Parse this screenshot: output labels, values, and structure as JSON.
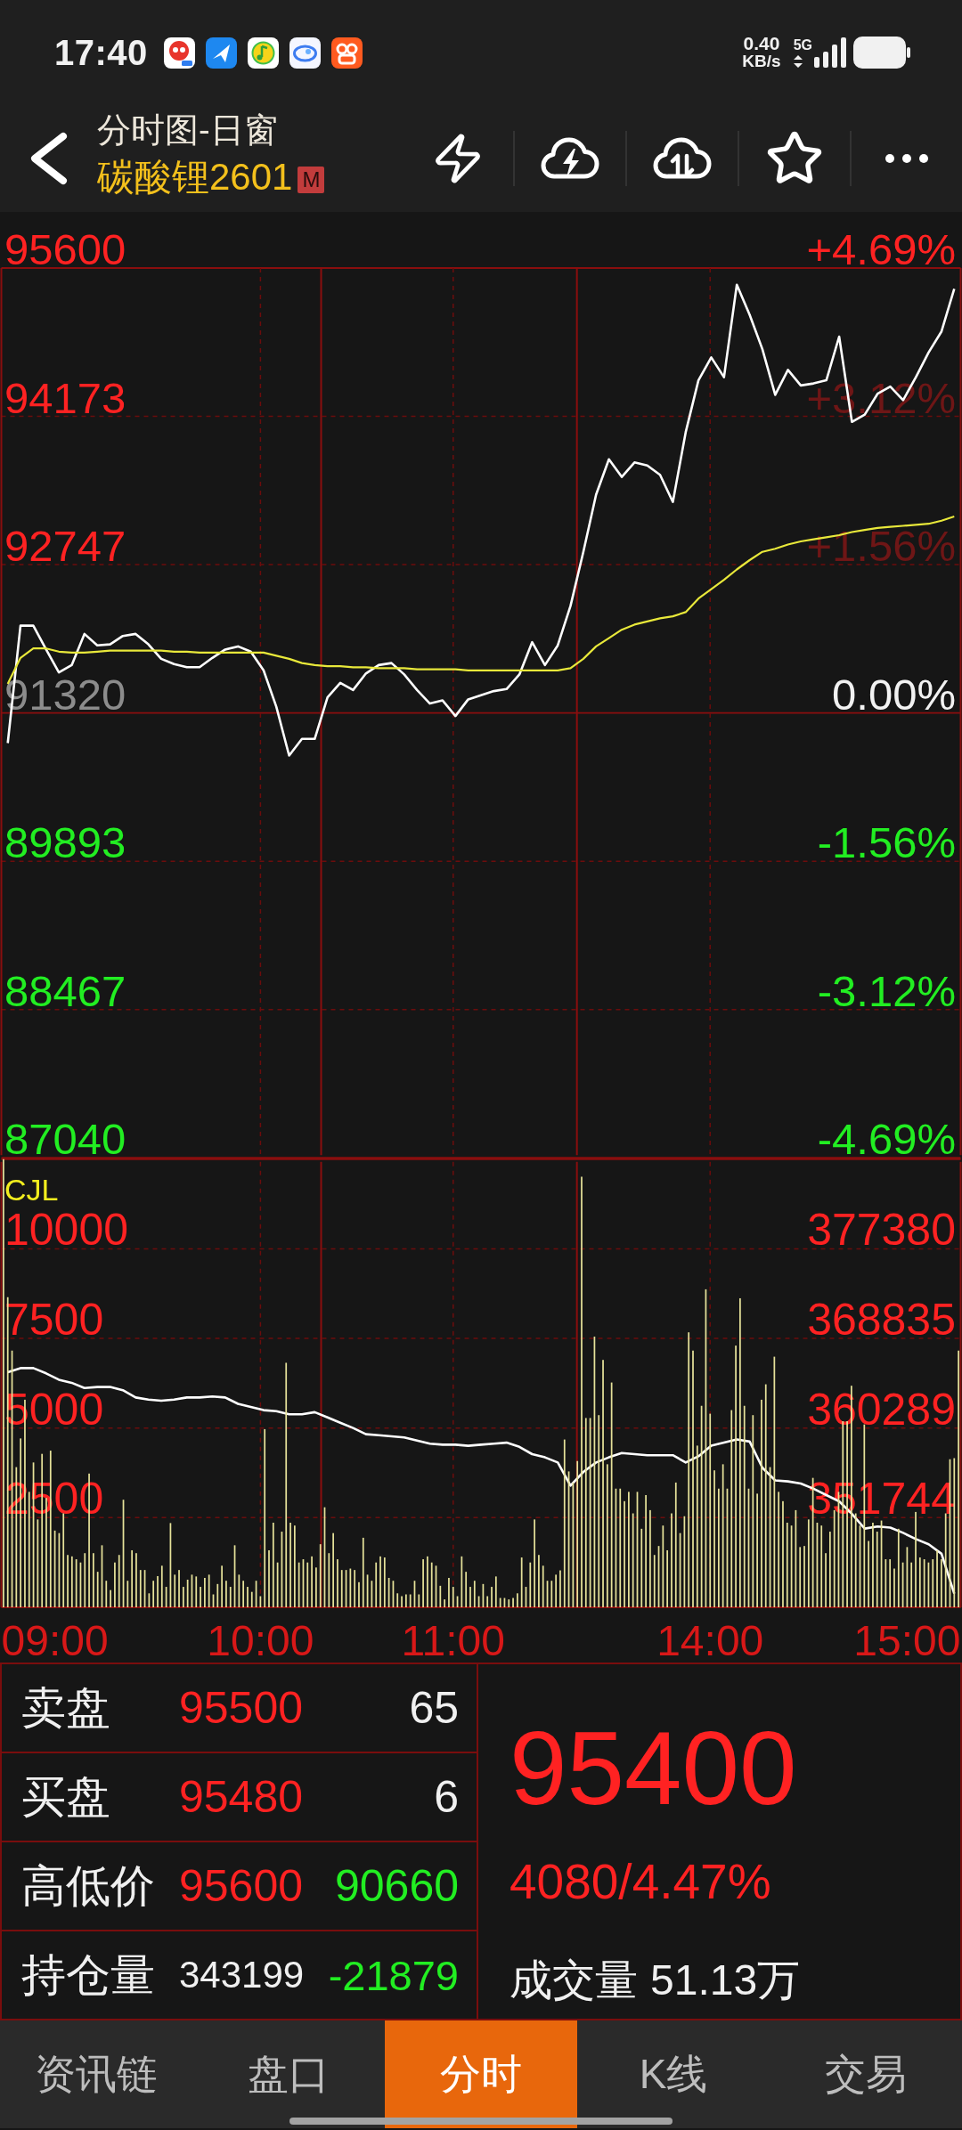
{
  "status_bar": {
    "time": "17:40",
    "net_speed": "0.40",
    "net_speed_unit": "KB/s",
    "network": "5G"
  },
  "header": {
    "title": "分时图-日窗",
    "contract": "碳酸锂2601",
    "badge": "M"
  },
  "price_chart": {
    "percent_labels": [
      {
        "text": "+4.69%",
        "dimmed": false
      },
      {
        "text": "+3.12%",
        "dimmed": true
      },
      {
        "text": "+1.56%",
        "dimmed": true
      },
      {
        "text": "0.00%",
        "dimmed": false
      },
      {
        "text": "-1.56%",
        "dimmed": false
      },
      {
        "text": "-3.12%",
        "dimmed": false
      },
      {
        "text": "-4.69%",
        "dimmed": false
      }
    ],
    "chart_data": {
      "type": "line",
      "grid": true,
      "categories": [
        null,
        null,
        null,
        null,
        null,
        null,
        null,
        null,
        null,
        null,
        null,
        null,
        null,
        null,
        null,
        null,
        null,
        null,
        null,
        null,
        null,
        null,
        null,
        null,
        null,
        null,
        null,
        null,
        null,
        null,
        null,
        null,
        null,
        null,
        null,
        null,
        null,
        null,
        null,
        null,
        null,
        null,
        null,
        null,
        null,
        null,
        null,
        null,
        null,
        null,
        null,
        null,
        null,
        null,
        null,
        null,
        null,
        null,
        null,
        null,
        null,
        null,
        null,
        null,
        null,
        null,
        null,
        null,
        null,
        null,
        null,
        null,
        null,
        null,
        null
      ],
      "series": [
        {
          "color": "#ffffff",
          "values": [
            91030,
            92160,
            92160,
            91930,
            91710,
            91780,
            92080,
            91970,
            91980,
            92060,
            92080,
            91980,
            91840,
            91790,
            91760,
            91760,
            91850,
            91930,
            91960,
            91910,
            91730,
            91380,
            90910,
            91070,
            91070,
            91470,
            91610,
            91540,
            91700,
            91780,
            91800,
            91690,
            91540,
            91410,
            91440,
            91290,
            91450,
            91490,
            91530,
            91550,
            91690,
            92000,
            91780,
            91970,
            92350,
            92870,
            93420,
            93760,
            93590,
            93730,
            93700,
            93610,
            93350,
            94020,
            94520,
            94740,
            94550,
            95440,
            95150,
            94820,
            94380,
            94620,
            94470,
            94490,
            94520,
            94940,
            94120,
            94190,
            94390,
            94460,
            94330,
            94550,
            94790,
            94990,
            95400
          ]
        },
        {
          "color": "#e8e83a",
          "values": [
            91600,
            91850,
            91940,
            91940,
            91910,
            91900,
            91900,
            91910,
            91920,
            91920,
            91920,
            91920,
            91920,
            91910,
            91910,
            91900,
            91900,
            91900,
            91900,
            91900,
            91900,
            91870,
            91840,
            91800,
            91780,
            91770,
            91770,
            91760,
            91760,
            91750,
            91750,
            91750,
            91740,
            91740,
            91740,
            91740,
            91730,
            91730,
            91730,
            91730,
            91730,
            91730,
            91730,
            91730,
            91750,
            91840,
            91960,
            92040,
            92120,
            92170,
            92200,
            92230,
            92250,
            92290,
            92420,
            92510,
            92600,
            92700,
            92790,
            92870,
            92900,
            92940,
            92970,
            92990,
            93010,
            93030,
            93060,
            93080,
            93100,
            93110,
            93120,
            93130,
            93140,
            93170,
            93210
          ]
        }
      ],
      "ylim": [
        87040,
        95600
      ],
      "yticks": [
        {
          "value": 95600,
          "label": "95600"
        },
        {
          "value": 94173.33,
          "label": "94173"
        },
        {
          "value": 92746.67,
          "label": "92747"
        },
        {
          "value": 91320,
          "label": "91320"
        },
        {
          "value": 89893.33,
          "label": "89893"
        },
        {
          "value": 88466.67,
          "label": "88467"
        },
        {
          "value": 87040,
          "label": "87040"
        }
      ]
    }
  },
  "volume_chart": {
    "label": "CJL",
    "chart_data": {
      "type": "bar",
      "grid": true,
      "categories": [
        null,
        null,
        null,
        null,
        null,
        null,
        null,
        null,
        null,
        null,
        null,
        null,
        "09:00",
        null,
        null,
        null,
        null,
        null,
        null,
        null,
        null,
        null,
        null,
        null,
        null,
        null,
        null,
        null,
        null,
        null,
        null,
        null,
        null,
        null,
        null,
        null,
        null,
        null,
        null,
        null,
        null,
        null,
        null,
        null,
        null,
        null,
        null,
        null,
        null,
        null,
        null,
        null,
        null,
        null,
        null,
        null,
        null,
        null,
        null,
        null,
        "10:00",
        null,
        null,
        null,
        null,
        null,
        null,
        null,
        null,
        null,
        null,
        null,
        null,
        null,
        null,
        null,
        null,
        null,
        null,
        null,
        null,
        null,
        null,
        null,
        null,
        null,
        null,
        null,
        null,
        null,
        null,
        null,
        null,
        null,
        null,
        null,
        null,
        null,
        null,
        null,
        null,
        null,
        null,
        null,
        null,
        "11:00",
        null,
        null,
        null,
        null,
        null,
        null,
        null,
        null,
        null,
        null,
        null,
        null,
        null,
        null,
        null,
        null,
        null,
        null,
        null,
        null,
        null,
        null,
        null,
        null,
        null,
        null,
        null,
        null,
        null,
        null,
        null,
        null,
        null,
        null,
        null,
        null,
        null,
        null,
        null,
        null,
        null,
        null,
        null,
        null,
        null,
        null,
        null,
        null,
        null,
        null,
        null,
        null,
        null,
        null,
        null,
        null,
        null,
        null,
        null,
        "14:00",
        null,
        null,
        null,
        null,
        null,
        null,
        null,
        null,
        null,
        null,
        null,
        null,
        null,
        null,
        null,
        null,
        null,
        null,
        null,
        null,
        null,
        null,
        null,
        null,
        null,
        null,
        null,
        null,
        null,
        null,
        null,
        null,
        null,
        null,
        null,
        null,
        null,
        null,
        null,
        null,
        null,
        null,
        null,
        null,
        null,
        "15:00",
        null,
        null,
        null,
        null,
        null,
        null,
        null,
        null,
        null,
        null,
        null,
        null
      ],
      "series": [
        {
          "color": "#e6e29a",
          "values": [
            12500,
            8650,
            7160,
            3910,
            4710,
            5790,
            3220,
            4040,
            2450,
            4280,
            3050,
            4370,
            2140,
            2070,
            2620,
            1460,
            1420,
            1340,
            1250,
            1510,
            3730,
            1510,
            990,
            1730,
            740,
            480,
            1250,
            1460,
            3000,
            740,
            1590,
            1510,
            1040,
            1040,
            390,
            740,
            870,
            1160,
            570,
            2350,
            910,
            1040,
            570,
            770,
            910,
            860,
            570,
            820,
            910,
            360,
            650,
            1160,
            740,
            570,
            1730,
            910,
            740,
            570,
            430,
            740,
            310,
            4970,
            1590,
            2360,
            1250,
            2110,
            6820,
            2360,
            2280,
            1250,
            1340,
            1250,
            1420,
            1110,
            1760,
            2790,
            1510,
            2070,
            1340,
            1040,
            1040,
            1080,
            1040,
            700,
            1940,
            910,
            740,
            1250,
            1420,
            1390,
            820,
            740,
            390,
            310,
            360,
            360,
            740,
            360,
            1340,
            1420,
            1250,
            1160,
            600,
            220,
            820,
            570,
            310,
            1420,
            990,
            570,
            740,
            310,
            650,
            310,
            570,
            860,
            260,
            260,
            220,
            260,
            390,
            1390,
            570,
            1250,
            2450,
            1460,
            1160,
            740,
            740,
            910,
            1030,
            4680,
            3790,
            3480,
            4080,
            12010,
            5280,
            5280,
            7550,
            5360,
            6900,
            3990,
            6270,
            3310,
            3310,
            2960,
            3220,
            2620,
            3220,
            2190,
            3130,
            2710,
            1460,
            1710,
            2280,
            1590,
            2620,
            3480,
            2070,
            2540,
            7670,
            7160,
            4510,
            5620,
            8870,
            5400,
            3820,
            3310,
            3990,
            3310,
            5500,
            7300,
            8620,
            5620,
            3310,
            5360,
            3170,
            5790,
            6220,
            3910,
            6990,
            3220,
            2960,
            2360,
            2280,
            2710,
            1680,
            1710,
            2450,
            3610,
            2360,
            2280,
            1510,
            2110,
            2710,
            3220,
            5190,
            5190,
            6180,
            2620,
            2280,
            5100,
            1850,
            2360,
            2110,
            2420,
            1340,
            1340,
            1080,
            2190,
            1250,
            1680,
            1250,
            2660,
            1390,
            1340,
            1250,
            1340,
            1590,
            1340,
            2620,
            4130,
            4160,
            7160
          ]
        }
      ],
      "ylim": [
        0,
        12500
      ],
      "yticks": [
        10000,
        7500,
        5000,
        2500
      ]
    },
    "open_interest": {
      "chart_data": {
        "type": "line",
        "categories": [
          null,
          null,
          null,
          null,
          null,
          null,
          null,
          null,
          null,
          null,
          null,
          null,
          null,
          null,
          null,
          null,
          null,
          null,
          null,
          null,
          null,
          null,
          null,
          null,
          null,
          null,
          null,
          null,
          null,
          null,
          null,
          null,
          null,
          null,
          null,
          null,
          null,
          null,
          null,
          null,
          null,
          null,
          null,
          null,
          null,
          null,
          null,
          null,
          null,
          null,
          null,
          null,
          null,
          null,
          null,
          null,
          null,
          null,
          null,
          null,
          null,
          null,
          null,
          null,
          null,
          null,
          null,
          null,
          null,
          null,
          null,
          null,
          null,
          null,
          null
        ],
        "series": [
          {
            "color": "#ffffff",
            "values": [
              365600,
              366000,
              366000,
              365500,
              364900,
              364600,
              364100,
              364200,
              364200,
              363900,
              363200,
              363000,
              362900,
              363000,
              363200,
              363200,
              363300,
              363200,
              362600,
              362300,
              362000,
              361900,
              361600,
              361600,
              361800,
              361300,
              360800,
              360300,
              359700,
              359600,
              359500,
              359400,
              359100,
              358800,
              358700,
              358700,
              358600,
              358700,
              358800,
              358900,
              358500,
              357800,
              357500,
              357000,
              354800,
              356100,
              357000,
              357500,
              357900,
              357800,
              357700,
              357700,
              357700,
              357000,
              357600,
              358600,
              358900,
              359200,
              359000,
              356500,
              355300,
              355200,
              355000,
              354500,
              353900,
              353300,
              352100,
              350700,
              350900,
              350800,
              350300,
              349700,
              349200,
              348300,
              344500
            ]
          }
        ],
        "ylim": [
          343199,
          385925
        ],
        "yticks": [
          377380,
          368835,
          360289,
          351744
        ]
      }
    }
  },
  "quote": {
    "rows": [
      {
        "kind": "order",
        "label": "卖盘",
        "price": "95500",
        "value": "65"
      },
      {
        "kind": "order",
        "label": "买盘",
        "price": "95480",
        "value": "6"
      },
      {
        "kind": "range",
        "label": "高低价",
        "price": "95600",
        "value": "90660"
      },
      {
        "kind": "position",
        "label": "持仓量",
        "price": "343199",
        "value": "-21879"
      }
    ],
    "last_price": "95400",
    "change": "4080/4.47%",
    "volume_label": "成交量",
    "volume": "51.13万"
  },
  "tabs": [
    {
      "label": "资讯链",
      "selected": false
    },
    {
      "label": "盘口",
      "selected": false
    },
    {
      "label": "分时",
      "selected": true
    },
    {
      "label": "K线",
      "selected": false
    },
    {
      "label": "交易",
      "selected": false
    }
  ]
}
